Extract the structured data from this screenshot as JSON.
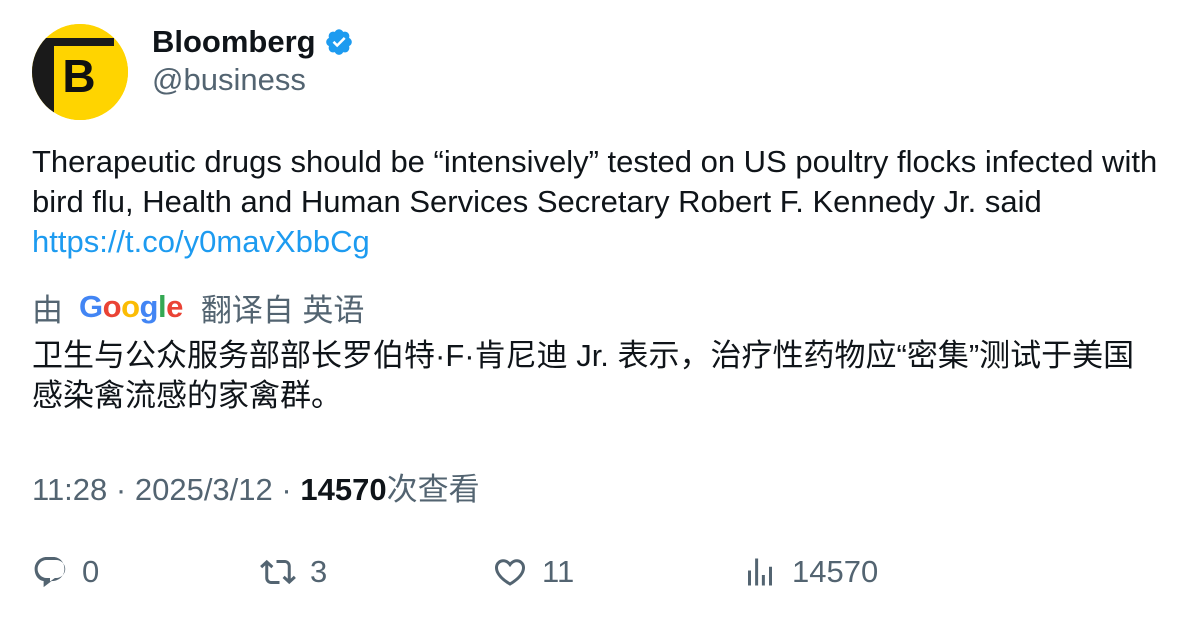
{
  "author": {
    "display_name": "Bloomberg",
    "handle": "@business",
    "avatar_letter": "B",
    "verified": true
  },
  "tweet": {
    "text": "Therapeutic drugs should be “intensively” tested on US poultry flocks infected with bird flu, Health and Human Services Secretary Robert F. Kennedy Jr. said",
    "link": "https://t.co/y0mavXbbCg"
  },
  "translation": {
    "prefix": "由",
    "provider": "Google",
    "suffix": "翻译自 英语",
    "text": "卫生与公众服务部部长罗伯特·F·肯尼迪 Jr. 表示，治疗性药物应“密集”测试于美国感染禽流感的家禽群。"
  },
  "meta": {
    "time": "11:28",
    "separator": "·",
    "date": "2025/3/12",
    "views_count": "14570",
    "views_label": "次查看"
  },
  "actions": {
    "reply": {
      "icon": "reply-icon",
      "count": "0"
    },
    "retweet": {
      "icon": "retweet-icon",
      "count": "3"
    },
    "like": {
      "icon": "heart-icon",
      "count": "11"
    },
    "views": {
      "icon": "views-icon",
      "count": "14570"
    }
  },
  "colors": {
    "link": "#1d9bf0",
    "verified": "#1d9bf0",
    "secondary_text": "#536471",
    "avatar_bg": "#ffd400"
  }
}
